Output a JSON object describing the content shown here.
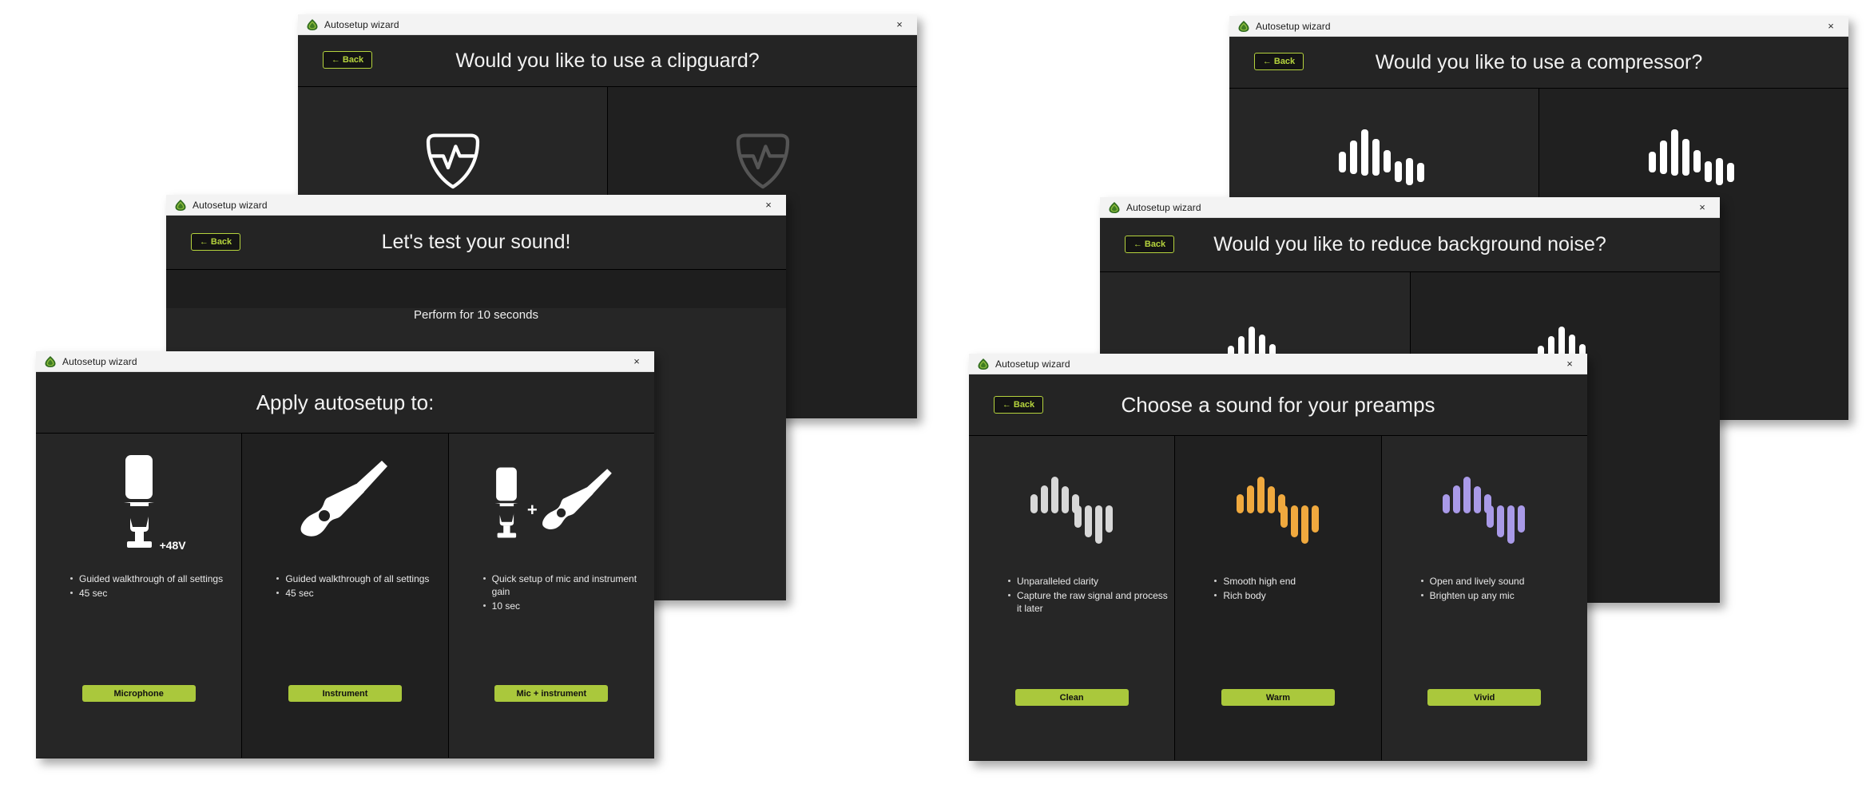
{
  "app": {
    "window_title": "Autosetup wizard",
    "title_icon": "autosetup-leaf-icon",
    "close_label": "×",
    "back_label": "← Back",
    "accent_green": "#aac83c",
    "back_border_green": "#b5d33d",
    "window_bg": "#1e1e1e",
    "header_bg": "#242424",
    "column_bg": "#262626",
    "column_alt_bg": "#202020"
  },
  "windows": {
    "clipguard": {
      "title": "Autosetup wizard",
      "heading": "Would you like to use a clipguard?",
      "back": "← Back",
      "close": "×",
      "options": [
        {
          "icon": "clipguard-on-icon",
          "color": "#ffffff"
        },
        {
          "icon": "clipguard-off-icon",
          "color": "#555555"
        }
      ]
    },
    "compressor": {
      "title": "Autosetup wizard",
      "heading": "Would you like to use a compressor?",
      "back": "← Back",
      "close": "×",
      "options": [
        {
          "icon": "compressor-on-waveform-icon",
          "color": "#ffffff"
        },
        {
          "icon": "compressor-off-waveform-icon",
          "color": "#ffffff"
        }
      ]
    },
    "test_sound": {
      "title": "Autosetup wizard",
      "heading": "Let's test your sound!",
      "back": "← Back",
      "close": "×",
      "note": "Perform for 10 seconds"
    },
    "noise": {
      "title": "Autosetup wizard",
      "heading": "Would you like to reduce background noise?",
      "back": "← Back",
      "close": "×",
      "options": [
        {
          "icon": "noise-on-waveform-icon",
          "color": "#ffffff"
        },
        {
          "icon": "noise-off-waveform-icon",
          "color": "#ffffff"
        }
      ]
    },
    "apply": {
      "title": "Autosetup wizard",
      "heading": "Apply autosetup to:",
      "close": "×",
      "columns": [
        {
          "icon": "microphone-icon",
          "badge": "+48V",
          "bullets": [
            "Guided walkthrough of all settings",
            "45 sec"
          ],
          "button": "Microphone"
        },
        {
          "icon": "guitar-icon",
          "badge": "",
          "bullets": [
            "Guided walkthrough of all settings",
            "45 sec"
          ],
          "button": "Instrument"
        },
        {
          "icon": "microphone-plus-guitar-icon",
          "badge": "+",
          "bullets": [
            "Quick setup of mic and instrument gain",
            "10 sec"
          ],
          "button": "Mic + instrument"
        }
      ]
    },
    "preamp": {
      "title": "Autosetup wizard",
      "heading": "Choose a sound for your preamps",
      "back": "← Back",
      "close": "×",
      "columns": [
        {
          "icon": "waveform-clean-icon",
          "color": "#d8d8d8",
          "bullets": [
            "Unparalleled clarity",
            "Capture the raw signal and process it later"
          ],
          "button": "Clean"
        },
        {
          "icon": "waveform-warm-icon",
          "color": "#f0a93e",
          "bullets": [
            "Smooth high end",
            "Rich body"
          ],
          "button": "Warm"
        },
        {
          "icon": "waveform-vivid-icon",
          "color": "#a99ae8",
          "bullets": [
            "Open and lively sound",
            "Brighten up any mic"
          ],
          "button": "Vivid"
        }
      ]
    }
  }
}
